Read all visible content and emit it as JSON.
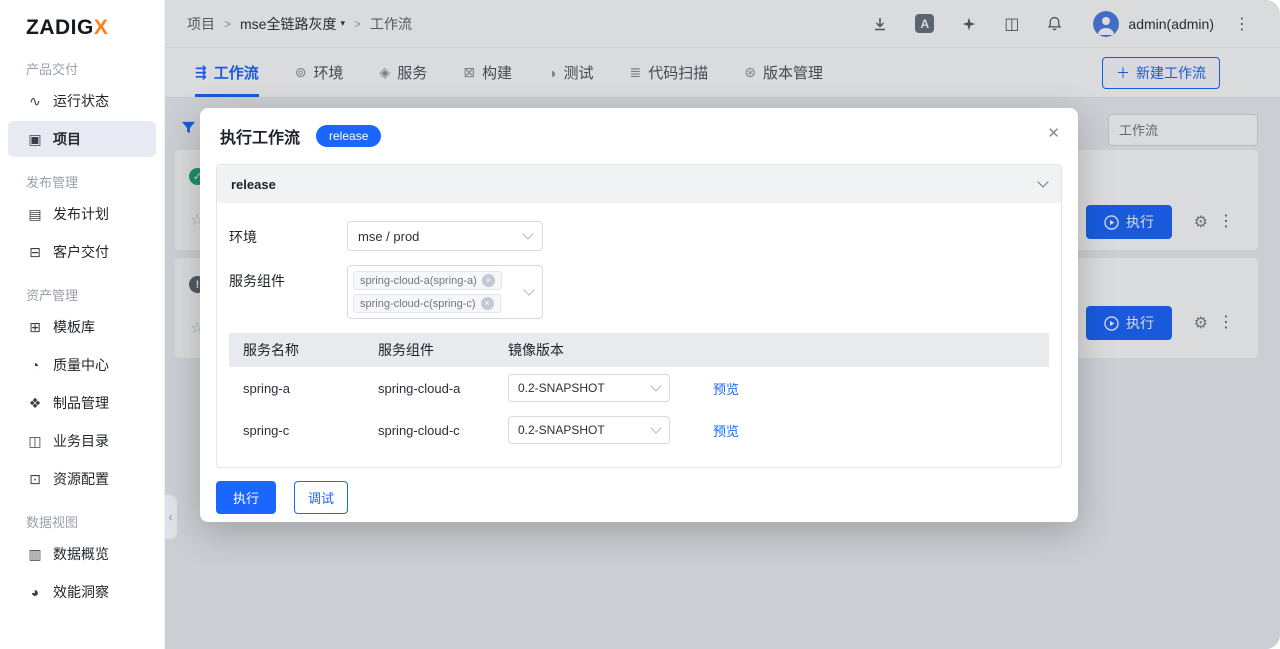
{
  "brand": {
    "name": "ZADIG",
    "accent": "X"
  },
  "colors": {
    "primary": "#1a66ff",
    "accent_orange": "#ff7d1a",
    "success": "#21a870"
  },
  "sidebar": {
    "sections": [
      {
        "label": "产品交付",
        "items": [
          {
            "label": "运行状态"
          },
          {
            "label": "项目",
            "active": true
          }
        ]
      },
      {
        "label": "发布管理",
        "items": [
          {
            "label": "发布计划"
          },
          {
            "label": "客户交付"
          }
        ]
      },
      {
        "label": "资产管理",
        "items": [
          {
            "label": "模板库"
          },
          {
            "label": "质量中心"
          },
          {
            "label": "制品管理"
          },
          {
            "label": "业务目录"
          },
          {
            "label": "资源配置"
          }
        ]
      },
      {
        "label": "数据视图",
        "items": [
          {
            "label": "数据概览"
          },
          {
            "label": "效能洞察"
          }
        ]
      }
    ]
  },
  "topbar": {
    "breadcrumb": {
      "root": "项目",
      "project": "mse全链路灰度",
      "current": "工作流"
    },
    "user": "admin(admin)"
  },
  "tabs": {
    "items": [
      {
        "label": "工作流"
      },
      {
        "label": "环境"
      },
      {
        "label": "服务"
      },
      {
        "label": "构建"
      },
      {
        "label": "测试"
      },
      {
        "label": "代码扫描"
      },
      {
        "label": "版本管理"
      }
    ],
    "active_index": 0
  },
  "toolbar": {
    "new_workflow_label": "新建工作流",
    "search_placeholder": "工作流"
  },
  "list": {
    "run_label": "执行"
  },
  "modal": {
    "title": "执行工作流",
    "badge": "release",
    "panel": {
      "title": "release",
      "env_label": "环境",
      "env_value": "mse / prod",
      "services_label": "服务组件",
      "service_tags": [
        {
          "text": "spring-cloud-a(spring-a)"
        },
        {
          "text": "spring-cloud-c(spring-c)"
        }
      ],
      "table": {
        "headers": [
          "服务名称",
          "服务组件",
          "镜像版本"
        ],
        "rows": [
          {
            "name": "spring-a",
            "component": "spring-cloud-a",
            "version": "0.2-SNAPSHOT",
            "action": "预览"
          },
          {
            "name": "spring-c",
            "component": "spring-cloud-c",
            "version": "0.2-SNAPSHOT",
            "action": "预览"
          }
        ]
      }
    },
    "footer": {
      "run": "执行",
      "debug": "调试"
    }
  },
  "icons": {
    "breadcrumb_sep": ">",
    "caret_down": "▾",
    "translate": "A",
    "panels": "◫",
    "kebab": "⋮",
    "gear": "⚙",
    "star": "☆",
    "check": "✓",
    "info": "!",
    "close": "✕",
    "plus": "＋",
    "collapse": "‹",
    "tag_close": "×",
    "sidebar": [
      "∿",
      "▣",
      "▤",
      "⊟",
      "⊞",
      "◔",
      "❖",
      "◫",
      "⊡",
      "▥",
      "◕"
    ],
    "tabs": [
      "⇶",
      "⊚",
      "◈",
      "⊠",
      "◑",
      "≣",
      "⊛"
    ]
  }
}
